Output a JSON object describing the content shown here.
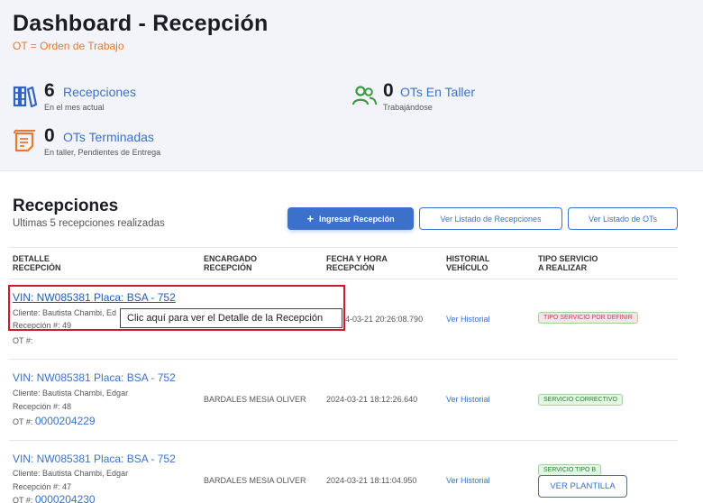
{
  "header": {
    "title": "Dashboard - Recepción",
    "subtitle": "OT = Orden de Trabajo"
  },
  "stats": {
    "recepciones": {
      "count": "6",
      "label": "Recepciones",
      "desc": "En el mes actual",
      "icon": "books-icon"
    },
    "en_taller": {
      "count": "0",
      "label": "OTs En Taller",
      "desc": "Trabajándose",
      "icon": "users-icon"
    },
    "terminadas": {
      "count": "0",
      "label": "OTs Terminadas",
      "desc": "En taller, Pendientes de Entrega",
      "icon": "document-icon"
    }
  },
  "section": {
    "title": "Recepciones",
    "subtitle": "Ultimas 5 recepciones realizadas",
    "btn_ingresar": "Ingresar Recepción",
    "btn_listado_recepciones": "Ver Listado de Recepciones",
    "btn_listado_ots": "Ver Listado de OTs"
  },
  "table": {
    "headers": {
      "detalle": "DETALLE\nRECEPCIÓN",
      "encargado": "ENCARGADO\nRECEPCIÓN",
      "fecha": "FECHA Y HORA\nRECEPCIÓN",
      "historial": "HISTORIAL\nVEHÍCULO",
      "tipo": "TIPO SERVICIO\nA REALIZAR"
    },
    "rows": [
      {
        "vin": "VIN: NW085381  Placa: BSA - 752",
        "cliente": "Cliente: Bautista Chambi, Ed",
        "recepcion": "Recepción #: 49",
        "ot_label": "OT #:",
        "ot_number": "",
        "encargado": "",
        "fecha": "4-03-21 20:26:08.790",
        "historial": "Ver Historial",
        "tipo": "TIPO SERVICIO POR DEFINIR"
      },
      {
        "vin": "VIN: NW085381  Placa: BSA - 752",
        "cliente": "Cliente: Bautista Chambi, Edgar",
        "recepcion": "Recepción #: 48",
        "ot_label": "OT #:",
        "ot_number": "0000204229",
        "encargado": "BARDALES MESIA OLIVER",
        "fecha": "2024-03-21 18:12:26.640",
        "historial": "Ver Historial",
        "tipo": "SERVICIO CORRECTIVO"
      },
      {
        "vin": "VIN: NW085381  Placa: BSA - 752",
        "cliente": "Cliente: Bautista Chambi, Edgar",
        "recepcion": "Recepción #: 47",
        "ot_label": "OT #:",
        "ot_number": "0000204230",
        "encargado": "BARDALES MESIA OLIVER",
        "fecha": "2024-03-21 18:11:04.950",
        "historial": "Ver Historial",
        "tipo": "SERVICIO TIPO B",
        "action": "VER PLANTILLA"
      }
    ]
  },
  "tooltip": "Clic aquí para ver el Detalle de la Recepción",
  "colors": {
    "primary": "#3b71ca",
    "accent": "#e8792f",
    "highlight": "#d0192e"
  }
}
